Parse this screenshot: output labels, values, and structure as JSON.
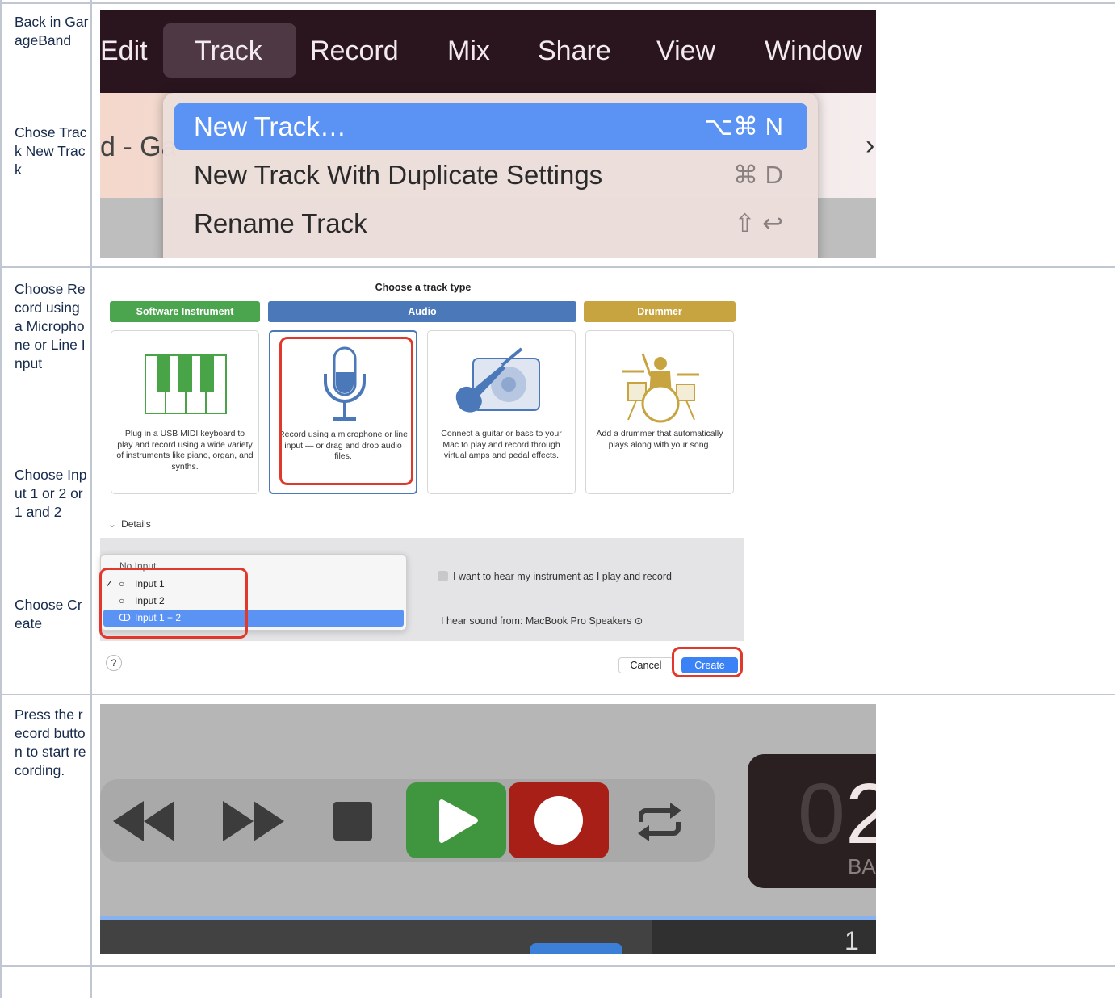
{
  "steps": [
    {
      "text": "Back in GarageBand"
    },
    {
      "text": "Chose Track New Track"
    },
    {
      "text": "Choose Record using a Microphone or Line Input"
    },
    {
      "text": "Choose Input 1 or 2 or 1 and 2"
    },
    {
      "text": "Choose Create"
    },
    {
      "text": "Press the record button to start recording."
    }
  ],
  "menu_bar": {
    "items": [
      "Edit",
      "Track",
      "Record",
      "Mix",
      "Share",
      "View",
      "Window"
    ],
    "active": "Track"
  },
  "background_text": "d - Ga",
  "track_menu": {
    "items": [
      {
        "label": "New Track…",
        "shortcut": "⌥⌘ N",
        "selected": true
      },
      {
        "label": "New Track With Duplicate Settings",
        "shortcut": "⌘ D",
        "selected": false
      },
      {
        "label": "Rename Track",
        "shortcut": "⇧ ↩",
        "selected": false
      }
    ]
  },
  "dialog": {
    "title": "Choose a track type",
    "categories": [
      {
        "label": "Software Instrument",
        "color": "#4aa54e"
      },
      {
        "label": "Audio",
        "color": "#4a78b8"
      },
      {
        "label": "Drummer",
        "color": "#c7a43f"
      }
    ],
    "cards": [
      {
        "icon": "piano-keys-icon",
        "description": "Plug in a USB MIDI keyboard to play and record using a wide variety of instruments like piano, organ, and synths."
      },
      {
        "icon": "microphone-icon",
        "description": "Record using a microphone or line input — or drag and drop audio files.",
        "selected": true
      },
      {
        "icon": "guitar-amp-icon",
        "description": "Connect a guitar or bass to your Mac to play and record through virtual amps and pedal effects."
      },
      {
        "icon": "drummer-icon",
        "description": "Add a drummer that automatically plays along with your song."
      }
    ],
    "details_label": "Details",
    "input_options": [
      {
        "label": "No Input",
        "checked": false
      },
      {
        "label": "Input 1",
        "checked": true
      },
      {
        "label": "Input 2",
        "checked": false
      },
      {
        "label": "Input 1 + 2",
        "checked": false,
        "highlighted": true
      }
    ],
    "monitoring_label": "I want to hear my instrument as I play and record",
    "output_label": "I hear sound from: MacBook Pro Speakers ⊙",
    "help_label": "?",
    "cancel_label": "Cancel",
    "create_label": "Create",
    "accent": "#3b82f6",
    "annotation_color": "#e0392b"
  },
  "transport": {
    "buttons": [
      "rewind-icon",
      "fast-forward-icon",
      "stop-icon",
      "play-icon",
      "record-icon",
      "cycle-icon"
    ],
    "play_color": "#3f963f",
    "record_color": "#a81f17",
    "lcd_dim": "0",
    "lcd_bright": "2",
    "lcd_label": "BA",
    "ruler_text": "1"
  }
}
